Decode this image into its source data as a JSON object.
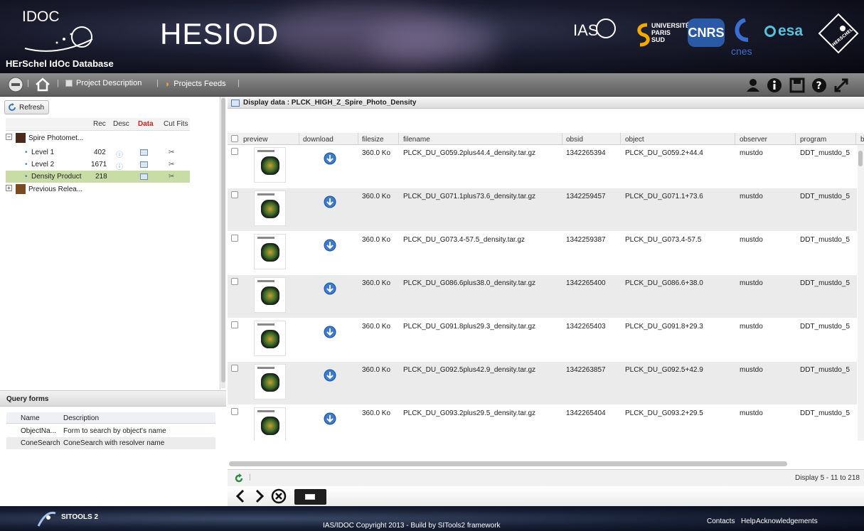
{
  "banner": {
    "idoc_label": "IDOC",
    "database_title": "HErSchel IdOc Database",
    "app_title": "HESIOD",
    "partners": {
      "ias": "IAS",
      "upsud": "UNIVERSITÉ PARIS SUD",
      "cnrs": "CNRS",
      "cnes": "cnes",
      "esa": "esa",
      "herschel": "HERSCHEL"
    }
  },
  "toolbar": {
    "project_description": "Project Description",
    "projects_feeds": "Projects Feeds",
    "separator": "|"
  },
  "left_panel": {
    "refresh_label": "Refresh",
    "columns": [
      "Rec",
      "Desc",
      "Data",
      "Cut Fits"
    ],
    "tree": [
      {
        "label": "Spire Photomet...",
        "level": 0,
        "expanded": true
      },
      {
        "label": "Level 1",
        "level": 1,
        "rec": "402"
      },
      {
        "label": "Level 2",
        "level": 1,
        "rec": "1671"
      },
      {
        "label": "Density Product",
        "level": 1,
        "rec": "218",
        "selected": true
      },
      {
        "label": "Previous Relea...",
        "level": 0,
        "expanded": false
      }
    ]
  },
  "query_forms": {
    "title": "Query forms",
    "columns": [
      "Name",
      "Description"
    ],
    "rows": [
      {
        "name": "ObjectNa...",
        "description": "Form to search by object's name"
      },
      {
        "name": "ConeSearch",
        "description": "ConeSearch with resolver name"
      }
    ]
  },
  "main": {
    "header_title": "Display data : PLCK_HIGH_Z_Spire_Photo_Density",
    "columns": [
      "preview",
      "download",
      "filesize",
      "filename",
      "obsid",
      "object",
      "observer",
      "program",
      "b"
    ],
    "rows": [
      {
        "filesize": "360.0 Ko",
        "filename": "PLCK_DU_G059.2plus44.4_density.tar.gz",
        "obsid": "1342265394",
        "object": "PLCK_DU_G059.2+44.4",
        "observer": "mustdo",
        "program": "DDT_mustdo_5"
      },
      {
        "filesize": "360.0 Ko",
        "filename": "PLCK_DU_G071.1plus73.6_density.tar.gz",
        "obsid": "1342259457",
        "object": "PLCK_DU_G071.1+73.6",
        "observer": "mustdo",
        "program": "DDT_mustdo_5"
      },
      {
        "filesize": "360.0 Ko",
        "filename": "PLCK_DU_G073.4-57.5_density.tar.gz",
        "obsid": "1342259387",
        "object": "PLCK_DU_G073.4-57.5",
        "observer": "mustdo",
        "program": "DDT_mustdo_5"
      },
      {
        "filesize": "360.0 Ko",
        "filename": "PLCK_DU_G086.6plus38.0_density.tar.gz",
        "obsid": "1342265400",
        "object": "PLCK_DU_G086.6+38.0",
        "observer": "mustdo",
        "program": "DDT_mustdo_5"
      },
      {
        "filesize": "360.0 Ko",
        "filename": "PLCK_DU_G091.8plus29.3_density.tar.gz",
        "obsid": "1342265403",
        "object": "PLCK_DU_G091.8+29.3",
        "observer": "mustdo",
        "program": "DDT_mustdo_5"
      },
      {
        "filesize": "360.0 Ko",
        "filename": "PLCK_DU_G092.5plus42.9_density.tar.gz",
        "obsid": "1342263857",
        "object": "PLCK_DU_G092.5+42.9",
        "observer": "mustdo",
        "program": "DDT_mustdo_5"
      },
      {
        "filesize": "360.0 Ko",
        "filename": "PLCK_DU_G093.2plus29.5_density.tar.gz",
        "obsid": "1342265404",
        "object": "PLCK_DU_G093.2+29.5",
        "observer": "mustdo",
        "program": "DDT_mustdo_5"
      }
    ],
    "paging": "Display 5 - 11 to 218"
  },
  "footer": {
    "sitools_label": "SITOOLS 2",
    "copyright": "IAS/IDOC Copyright 2013 - Build by SITools2 framework",
    "links": [
      "Contacts",
      "Help",
      "Acknowledgements"
    ]
  },
  "colors": {
    "selected_row": "#c8dca6",
    "accent_red": "#cc2222",
    "download_blue": "#3a7bd5"
  }
}
